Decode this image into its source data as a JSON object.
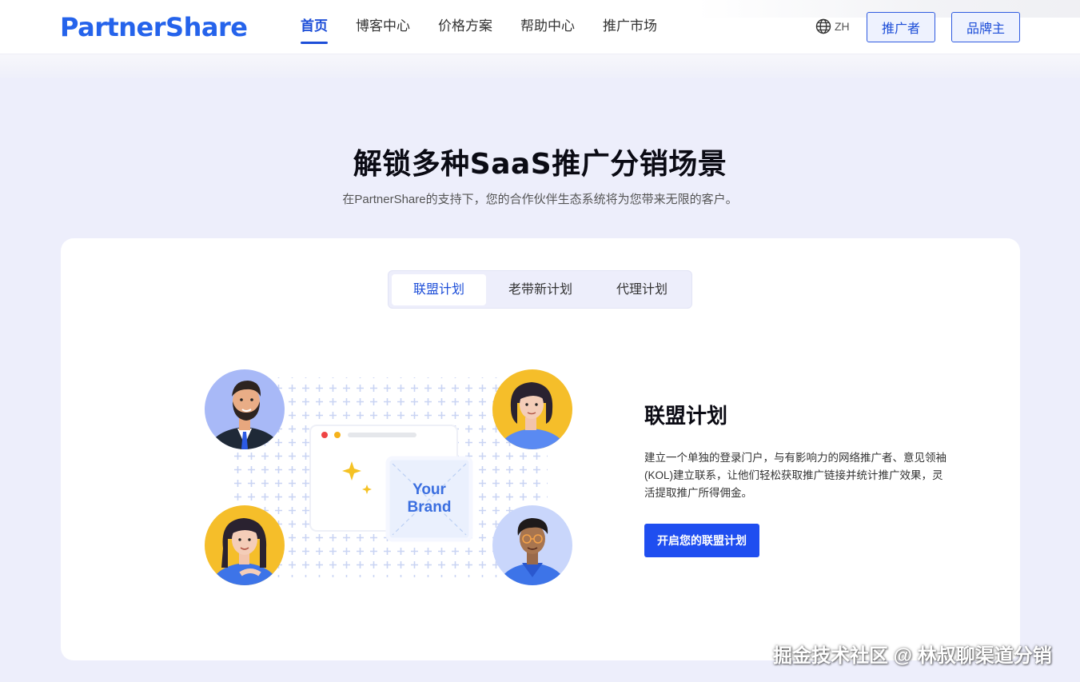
{
  "brand": {
    "logo_text": "PartnerShare",
    "accent": "#1d4ed8",
    "cta_color": "#1f4ef0"
  },
  "nav": {
    "items": [
      {
        "label": "首页",
        "active": true
      },
      {
        "label": "博客中心"
      },
      {
        "label": "价格方案"
      },
      {
        "label": "帮助中心"
      },
      {
        "label": "推广市场"
      }
    ],
    "lang_icon": "globe-icon",
    "lang": "ZH",
    "btn_promoter": "推广者",
    "btn_brand": "品牌主"
  },
  "hero": {
    "title": "解锁多种SaaS推广分销场景",
    "subtitle": "在PartnerShare的支持下，您的合作伙伴生态系统将为您带来无限的客户。"
  },
  "tabs": [
    {
      "label": "联盟计划",
      "active": true
    },
    {
      "label": "老带新计划"
    },
    {
      "label": "代理计划"
    }
  ],
  "illustration": {
    "brand_line1": "Your",
    "brand_line2": "Brand"
  },
  "feature": {
    "title": "联盟计划",
    "description": "建立一个单独的登录门户，与有影响力的网络推广者、意见领袖(KOL)建立联系，让他们轻松获取推广链接并统计推广效果，灵活提取推广所得佣金。",
    "cta": "开启您的联盟计划"
  },
  "watermark": "掘金技术社区 @ 林叔聊渠道分销"
}
